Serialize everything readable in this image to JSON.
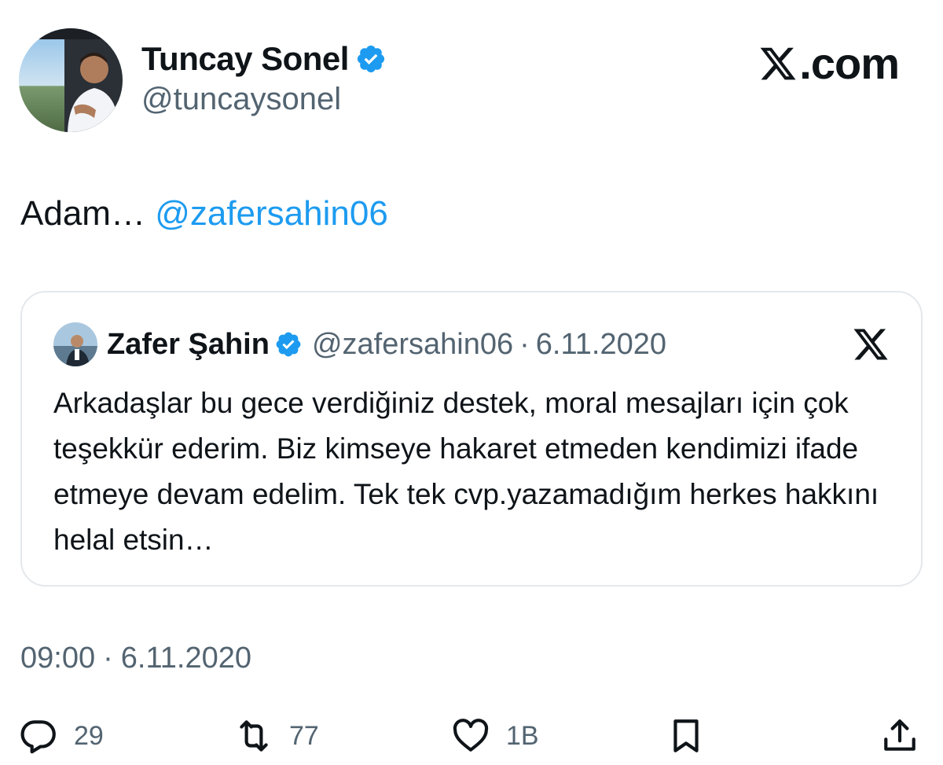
{
  "author": {
    "name": "Tuncay Sonel",
    "handle": "@tuncaysonel",
    "verified": true,
    "avatar_icon": "profile-photo"
  },
  "brand": {
    "label": ".com",
    "icon": "x-logo-icon"
  },
  "tweet": {
    "text": "Adam…",
    "mention": "@zafersahin06"
  },
  "quote": {
    "name": "Zafer Şahin",
    "handle": "@zafersahin06",
    "separator": "·",
    "date": "6.11.2020",
    "verified": true,
    "text": "Arkadaşlar bu gece verdiğiniz destek, moral mesajları için çok teşekkür ederim. Biz kimseye hakaret etmeden kendimizi ifade etmeye devam edelim. Tek tek cvp.yazamadığım herkes hakkını helal etsin…"
  },
  "timestamp": {
    "time": "09:00",
    "separator": "·",
    "date": "6.11.2020"
  },
  "actions": {
    "replies": "29",
    "retweets": "77",
    "likes": "1B"
  },
  "colors": {
    "accent": "#1d9bf0",
    "muted": "#536471",
    "border": "#e4e8ec",
    "text": "#0f1419"
  }
}
